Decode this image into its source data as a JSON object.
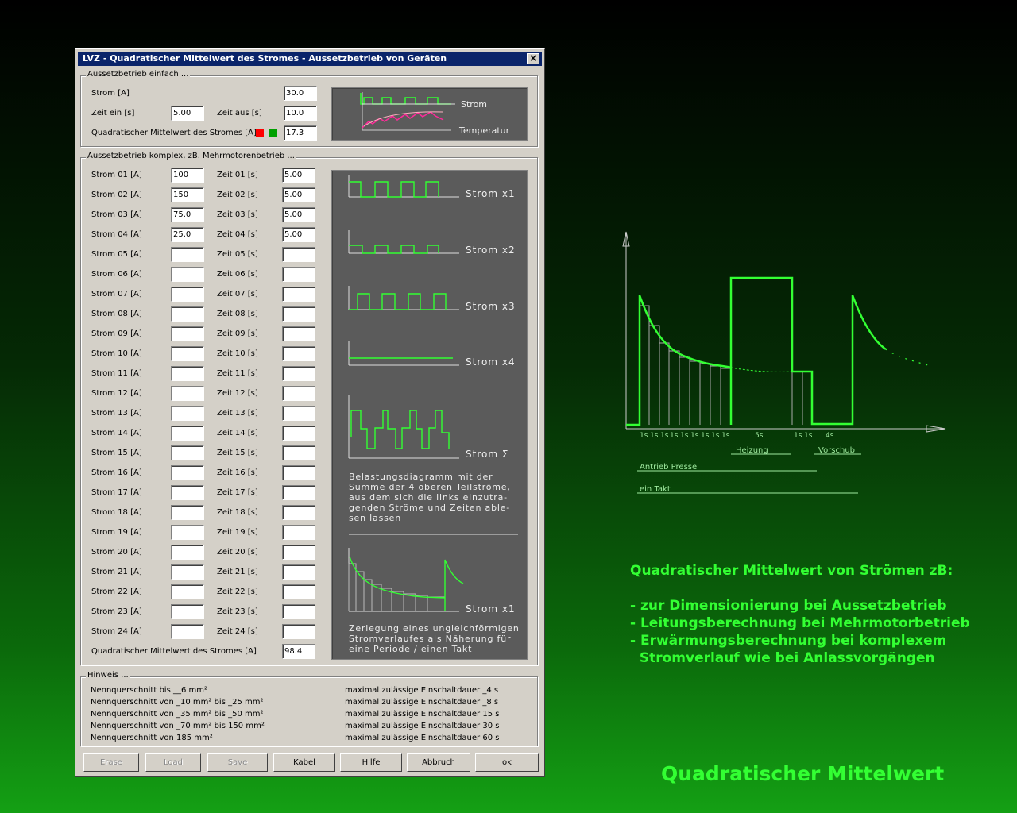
{
  "window": {
    "title": "LVZ - Quadratischer Mittelwert des Stromes - Aussetzbetrieb von Geräten",
    "close": "×"
  },
  "simple": {
    "group_label": "Aussetzbetrieb einfach ...",
    "strom_label": "Strom [A]",
    "strom_value": "30.0",
    "zeit_ein_label": "Zeit ein [s]",
    "zeit_ein_value": "5.00",
    "zeit_aus_label": "Zeit aus [s]",
    "zeit_aus_value": "10.0",
    "result_label": "Quadratischer Mittelwert des Stromes [A]",
    "result_value": "17.3",
    "diagram_labels": {
      "strom": "Strom",
      "temperatur": "Temperatur"
    },
    "indicator_colors": [
      "#ff0000",
      "#00a000"
    ]
  },
  "complex": {
    "group_label": "Aussetzbetrieb komplex, zB. Mehrmotorenbetrieb ...",
    "rows": [
      {
        "strom_label": "Strom 01 [A]",
        "strom": "100",
        "zeit_label": "Zeit 01 [s]",
        "zeit": "5.00"
      },
      {
        "strom_label": "Strom 02 [A]",
        "strom": "150",
        "zeit_label": "Zeit 02 [s]",
        "zeit": "5.00"
      },
      {
        "strom_label": "Strom 03 [A]",
        "strom": "75.0",
        "zeit_label": "Zeit 03 [s]",
        "zeit": "5.00"
      },
      {
        "strom_label": "Strom 04 [A]",
        "strom": "25.0",
        "zeit_label": "Zeit 04 [s]",
        "zeit": "5.00"
      },
      {
        "strom_label": "Strom 05 [A]",
        "strom": "",
        "zeit_label": "Zeit 05 [s]",
        "zeit": ""
      },
      {
        "strom_label": "Strom 06 [A]",
        "strom": "",
        "zeit_label": "Zeit 06 [s]",
        "zeit": ""
      },
      {
        "strom_label": "Strom 07 [A]",
        "strom": "",
        "zeit_label": "Zeit 07 [s]",
        "zeit": ""
      },
      {
        "strom_label": "Strom 08 [A]",
        "strom": "",
        "zeit_label": "Zeit 08 [s]",
        "zeit": ""
      },
      {
        "strom_label": "Strom 09 [A]",
        "strom": "",
        "zeit_label": "Zeit 09 [s]",
        "zeit": ""
      },
      {
        "strom_label": "Strom 10 [A]",
        "strom": "",
        "zeit_label": "Zeit 10 [s]",
        "zeit": ""
      },
      {
        "strom_label": "Strom 11 [A]",
        "strom": "",
        "zeit_label": "Zeit 11 [s]",
        "zeit": ""
      },
      {
        "strom_label": "Strom 12 [A]",
        "strom": "",
        "zeit_label": "Zeit 12 [s]",
        "zeit": ""
      },
      {
        "strom_label": "Strom 13 [A]",
        "strom": "",
        "zeit_label": "Zeit 13 [s]",
        "zeit": ""
      },
      {
        "strom_label": "Strom 14 [A]",
        "strom": "",
        "zeit_label": "Zeit 14 [s]",
        "zeit": ""
      },
      {
        "strom_label": "Strom 15 [A]",
        "strom": "",
        "zeit_label": "Zeit 15 [s]",
        "zeit": ""
      },
      {
        "strom_label": "Strom 16 [A]",
        "strom": "",
        "zeit_label": "Zeit 16 [s]",
        "zeit": ""
      },
      {
        "strom_label": "Strom 17 [A]",
        "strom": "",
        "zeit_label": "Zeit 17 [s]",
        "zeit": ""
      },
      {
        "strom_label": "Strom 18 [A]",
        "strom": "",
        "zeit_label": "Zeit 18 [s]",
        "zeit": ""
      },
      {
        "strom_label": "Strom 19 [A]",
        "strom": "",
        "zeit_label": "Zeit 19 [s]",
        "zeit": ""
      },
      {
        "strom_label": "Strom 20 [A]",
        "strom": "",
        "zeit_label": "Zeit 20 [s]",
        "zeit": ""
      },
      {
        "strom_label": "Strom 21 [A]",
        "strom": "",
        "zeit_label": "Zeit 21 [s]",
        "zeit": ""
      },
      {
        "strom_label": "Strom 22 [A]",
        "strom": "",
        "zeit_label": "Zeit 22 [s]",
        "zeit": ""
      },
      {
        "strom_label": "Strom 23 [A]",
        "strom": "",
        "zeit_label": "Zeit 23 [s]",
        "zeit": ""
      },
      {
        "strom_label": "Strom 24 [A]",
        "strom": "",
        "zeit_label": "Zeit 24 [s]",
        "zeit": ""
      }
    ],
    "result_label": "Quadratischer Mittelwert des Stromes [A]",
    "result_value": "98.4",
    "diagram": {
      "strom_x1": "Strom  x1",
      "strom_x2": "Strom  x2",
      "strom_x3": "Strom  x3",
      "strom_x4": "Strom  x4",
      "strom_sum": "Strom  Σ",
      "text1": [
        "Belastungsdiagramm mit der",
        "Summe der 4 oberen Teilströme,",
        "aus dem sich die links einzutra-",
        "genden Ströme und Zeiten able-",
        "sen lassen"
      ],
      "strom_x1b": "Strom  x1",
      "text2": [
        "Zerlegung eines ungleichförmigen",
        "Stromverlaufes als Näherung für",
        "eine Periode / einen Takt"
      ]
    }
  },
  "hinweis": {
    "group_label": "Hinweis ...",
    "rows": [
      {
        "left": "Nennquerschnitt bis  __6 mm²",
        "right": "maximal zulässige Einschaltdauer _4 s"
      },
      {
        "left": "Nennquerschnitt von _10 mm² bis _25 mm²",
        "right": "maximal zulässige Einschaltdauer _8 s"
      },
      {
        "left": "Nennquerschnitt von _35 mm² bis _50 mm²",
        "right": "maximal zulässige Einschaltdauer 15 s"
      },
      {
        "left": "Nennquerschnitt von _70 mm² bis 150 mm²",
        "right": "maximal zulässige Einschaltdauer 30 s"
      },
      {
        "left": "Nennquerschnitt von 185 mm²",
        "right": "maximal zulässige Einschaltdauer 60 s"
      }
    ]
  },
  "buttons": {
    "erase": "Erase",
    "load": "Load",
    "save": "Save",
    "kabel": "Kabel",
    "hilfe": "Hilfe",
    "abbruch": "Abbruch",
    "ok": "ok"
  },
  "right_chart": {
    "tick_labels": [
      "1s",
      "1s",
      "1s",
      "1s",
      "1s",
      "1s",
      "1s",
      "1s",
      "1s",
      "5s",
      "1s",
      "1s",
      "4s"
    ],
    "heizung": "Heizung",
    "vorschub": "Vorschub",
    "antrieb": "Antrieb  Presse",
    "takt": "ein  Takt"
  },
  "info": {
    "heading": "Quadratischer Mittelwert von Strömen zB:",
    "bullets": [
      "- zur Dimensionierung bei Aussetzbetrieb",
      "- Leitungsberechnung bei Mehrmotorbetrieb",
      "- Erwärmungsberechnung bei komplexem",
      "  Stromverlauf wie bei Anlassvorgängen"
    ],
    "footer": "Quadratischer Mittelwert"
  },
  "colors": {
    "trace_green": "#33ff33",
    "titlebar": "#0a246a",
    "panel": "#5b5b5b"
  }
}
